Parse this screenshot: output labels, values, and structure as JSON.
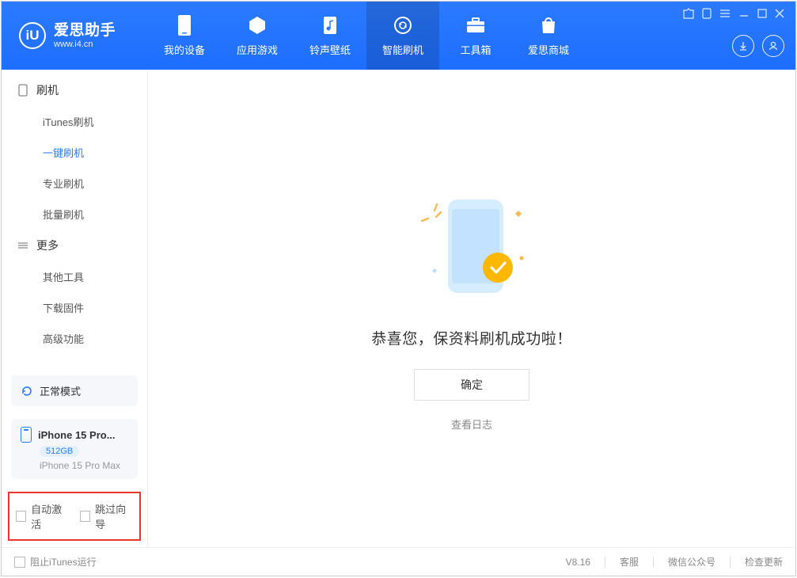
{
  "app": {
    "logo_initials": "iU",
    "title": "爱思助手",
    "subtitle": "www.i4.cn"
  },
  "nav": {
    "items": [
      {
        "label": "我的设备"
      },
      {
        "label": "应用游戏"
      },
      {
        "label": "铃声壁纸"
      },
      {
        "label": "智能刷机",
        "active": true
      },
      {
        "label": "工具箱"
      },
      {
        "label": "爱思商城"
      }
    ]
  },
  "sidebar": {
    "group1": {
      "label": "刷机",
      "items": [
        {
          "label": "iTunes刷机"
        },
        {
          "label": "一键刷机",
          "active": true
        },
        {
          "label": "专业刷机"
        },
        {
          "label": "批量刷机"
        }
      ]
    },
    "group2": {
      "label": "更多",
      "items": [
        {
          "label": "其他工具"
        },
        {
          "label": "下载固件"
        },
        {
          "label": "高级功能"
        }
      ]
    },
    "mode_label": "正常模式",
    "device": {
      "name": "iPhone 15 Pro...",
      "storage": "512GB",
      "model": "iPhone 15 Pro Max"
    },
    "checkboxes": {
      "auto_activate": "自动激活",
      "skip_wizard": "跳过向导"
    }
  },
  "main": {
    "success_message": "恭喜您，保资料刷机成功啦！",
    "ok_button": "确定",
    "view_log": "查看日志"
  },
  "statusbar": {
    "block_itunes": "阻止iTunes运行",
    "version": "V8.16",
    "support": "客服",
    "wechat": "微信公众号",
    "update": "检查更新"
  }
}
